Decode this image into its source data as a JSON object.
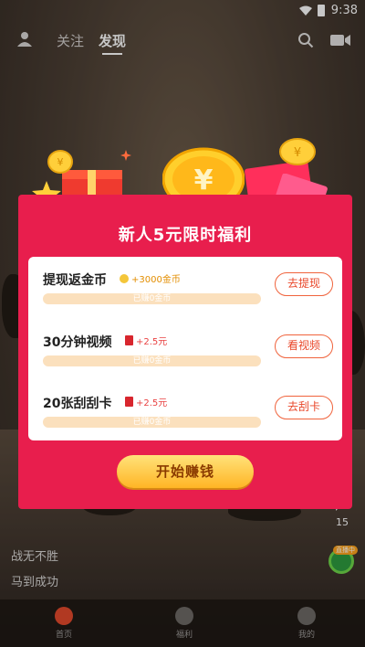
{
  "status": {
    "time": "9:38"
  },
  "topnav": {
    "tab_follow": "关注",
    "tab_discover": "发现"
  },
  "side": {
    "comment_count": "15",
    "live_tag": "直播中"
  },
  "captions": {
    "line1": "战无不胜",
    "line2": "马到成功"
  },
  "bottombar": {
    "home": "首页",
    "task": "福利",
    "profile": "我的"
  },
  "modal": {
    "title": "新人5元限时福利",
    "tasks": [
      {
        "title": "提现返金币",
        "reward": "+3000金币",
        "progress_label": "已赚0金币",
        "progress": 0,
        "button": "去提现"
      },
      {
        "title": "30分钟视频",
        "reward": "+2.5元",
        "progress_label": "已赚0金币",
        "progress": 0,
        "button": "看视频"
      },
      {
        "title": "20张刮刮卡",
        "reward": "+2.5元",
        "progress_label": "已赚0金币",
        "progress": 0,
        "button": "去刮卡"
      }
    ],
    "cta": "开始赚钱"
  },
  "colors": {
    "modal": "#e81e4d",
    "cta": "#ffc83a",
    "accent": "#f0633c"
  }
}
